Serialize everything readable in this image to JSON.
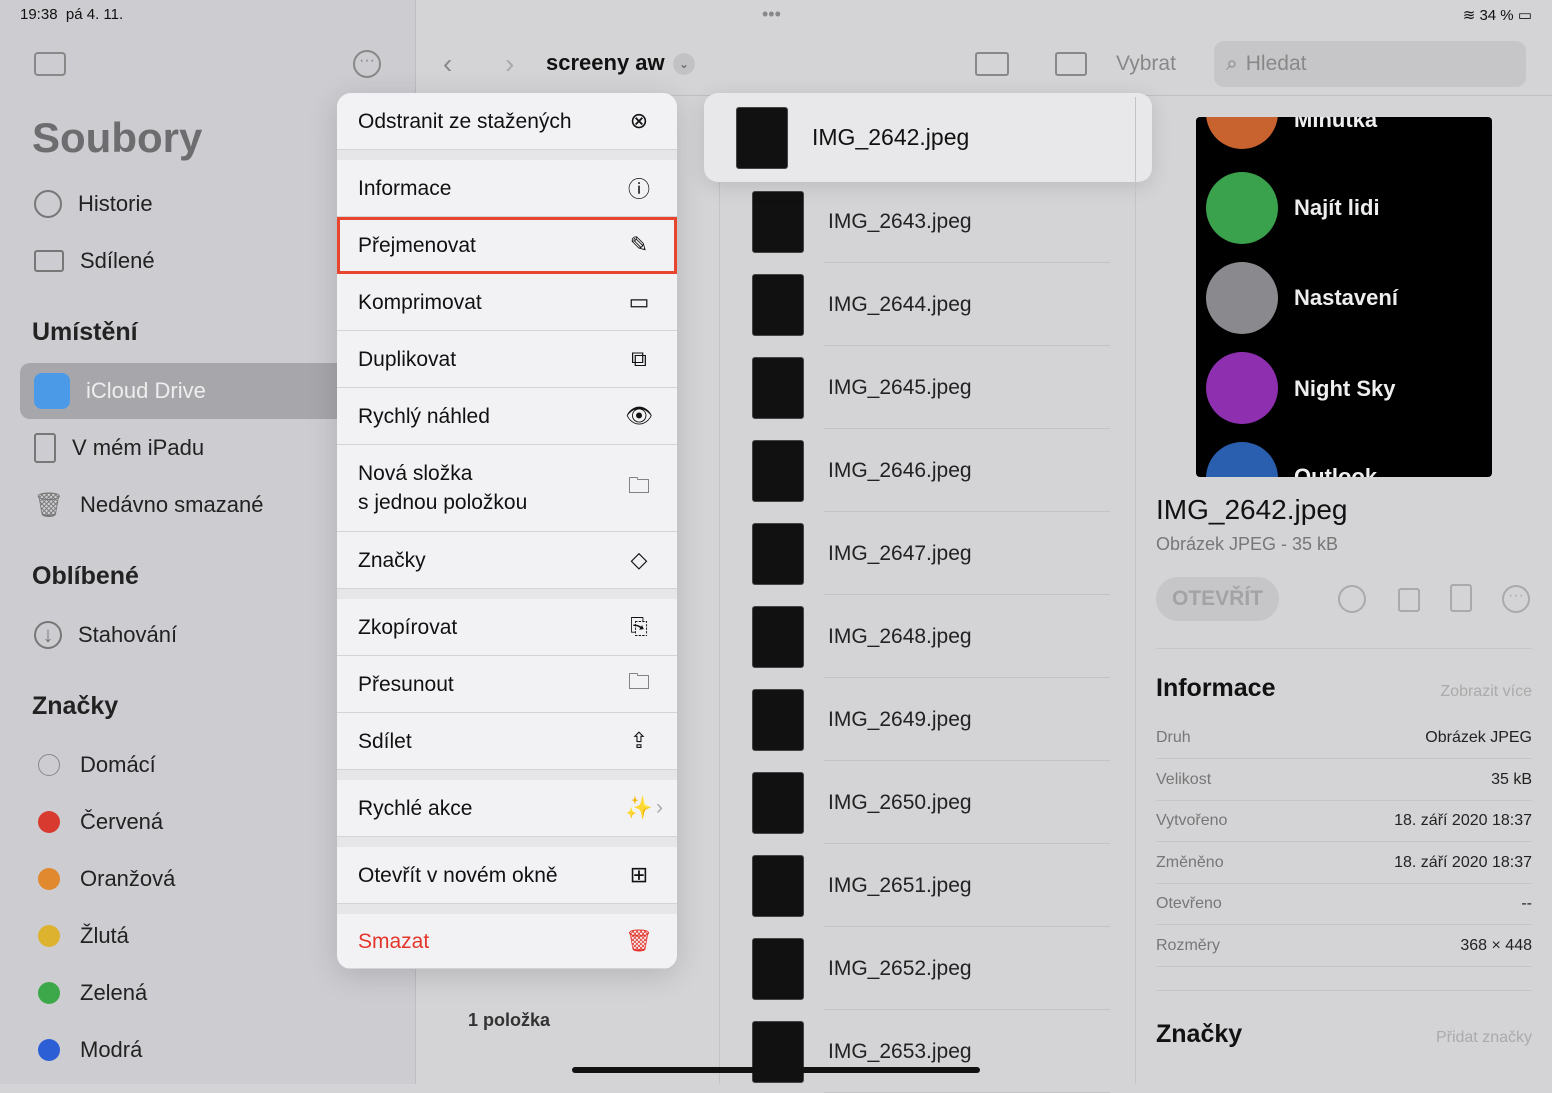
{
  "status": {
    "time": "19:38",
    "date": "pá 4. 11.",
    "battery": "34 %"
  },
  "sidebar": {
    "title": "Soubory",
    "items": [
      {
        "label": "Historie",
        "icon": "clock-icon"
      },
      {
        "label": "Sdílené",
        "icon": "shared-folder-icon"
      }
    ],
    "locations_header": "Umístění",
    "locations": [
      {
        "label": "iCloud Drive"
      },
      {
        "label": "V mém iPadu"
      },
      {
        "label": "Nedávno smazané"
      }
    ],
    "favorites_header": "Oblíbené",
    "favorites": [
      {
        "label": "Stahování"
      }
    ],
    "tags_header": "Značky",
    "tags": [
      {
        "label": "Domácí",
        "color": ""
      },
      {
        "label": "Červená",
        "color": "#d93a2f"
      },
      {
        "label": "Oranžová",
        "color": "#e0892e"
      },
      {
        "label": "Žlutá",
        "color": "#dcb22f"
      },
      {
        "label": "Zelená",
        "color": "#3da84a"
      },
      {
        "label": "Modrá",
        "color": "#2c5fd6"
      }
    ]
  },
  "toolbar": {
    "folder": "screeny aw",
    "select": "Vybrat",
    "search_placeholder": "Hledat"
  },
  "menu": [
    {
      "label": "Odstranit ze stažených",
      "icon": "⊗"
    },
    {
      "label": "Informace",
      "icon": "ⓘ"
    },
    {
      "label": "Přejmenovat",
      "icon": "✎"
    },
    {
      "label": "Komprimovat",
      "icon": "▭"
    },
    {
      "label": "Duplikovat",
      "icon": "⧉"
    },
    {
      "label": "Rychlý náhled",
      "icon": "👁"
    },
    {
      "label": "Nová složka\ns jednou položkou",
      "icon": "🗀"
    },
    {
      "label": "Značky",
      "icon": "◇"
    },
    {
      "label": "Zkopírovat",
      "icon": "⎘"
    },
    {
      "label": "Přesunout",
      "icon": "🗀"
    },
    {
      "label": "Sdílet",
      "icon": "⇪"
    },
    {
      "label": "Rychlé akce",
      "icon": "✨"
    },
    {
      "label": "Otevřít v novém okně",
      "icon": "⊞"
    },
    {
      "label": "Smazat",
      "icon": "🗑"
    }
  ],
  "preview_card": {
    "name": "IMG_2642.jpeg"
  },
  "files": [
    "IMG_2643.jpeg",
    "IMG_2644.jpeg",
    "IMG_2645.jpeg",
    "IMG_2646.jpeg",
    "IMG_2647.jpeg",
    "IMG_2648.jpeg",
    "IMG_2649.jpeg",
    "IMG_2650.jpeg",
    "IMG_2651.jpeg",
    "IMG_2652.jpeg",
    "IMG_2653.jpeg"
  ],
  "item_count": "1 položka",
  "detail": {
    "watch_apps": [
      "Minutka",
      "Najít lidi",
      "Nastavení",
      "Night Sky",
      "Outlook"
    ],
    "name": "IMG_2642.jpeg",
    "subtitle": "Obrázek JPEG - 35 kB",
    "open": "OTEVŘÍT",
    "info_header": "Informace",
    "show_more": "Zobrazit více",
    "info": [
      {
        "k": "Druh",
        "v": "Obrázek JPEG"
      },
      {
        "k": "Velikost",
        "v": "35 kB"
      },
      {
        "k": "Vytvořeno",
        "v": "18. září 2020 18:37"
      },
      {
        "k": "Změněno",
        "v": "18. září 2020 18:37"
      },
      {
        "k": "Otevřeno",
        "v": "--"
      },
      {
        "k": "Rozměry",
        "v": "368 × 448"
      }
    ],
    "tags_header": "Značky",
    "add_tags": "Přidat značky"
  }
}
